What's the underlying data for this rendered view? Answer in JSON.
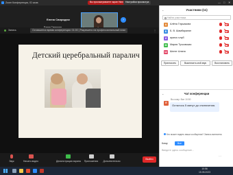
{
  "window": {
    "app_title": "Zoom Конференция, ID зала",
    "banner_red": "Вы просматриваете экран Нина",
    "banner_view": "Настройки просмотра",
    "controls": [
      "—",
      "□",
      "✕"
    ]
  },
  "videos": {
    "tile1_name": "Елена Свиридюк",
    "tile1_caption": "Елена Свиридюк",
    "tile2_caption": "Национальный институт"
  },
  "share_bar": {
    "view_label": "Запись",
    "notice": "Оставшееся время конференции: 01:00 | Разрешено на профессиональный план"
  },
  "slide": {
    "title": "Детский церебральный паралич"
  },
  "toolbar": {
    "items": [
      {
        "label": "Звук"
      },
      {
        "label": "Начать видео"
      },
      {
        "label": "Демонстрация экрана"
      },
      {
        "label": "Приложения"
      },
      {
        "label": "Дополнительно"
      }
    ],
    "exit": "Выйти"
  },
  "participants": {
    "title": "Участники (11)",
    "search_placeholder": "Найти участника",
    "list": [
      {
        "initials": "А",
        "name": "Алёна Глушакова",
        "color": "#e38a3a"
      },
      {
        "initials": "Б",
        "name": "Б. В. Шамбаранян",
        "color": "#3a8ee3"
      },
      {
        "initials": "И",
        "name": "ирина голуб",
        "color": "#8a5ce3"
      },
      {
        "initials": "М",
        "name": "Мария Тучковская",
        "color": "#3ebd4b"
      },
      {
        "initials": "Ш",
        "name": "Шелег Алина",
        "color": "#e34a6a"
      }
    ],
    "buttons": [
      "Пригласить",
      "Выключить мой звук",
      "Восстановить"
    ]
  },
  "chat": {
    "title": "Чат конференции",
    "meta": "Вы кому: Все  10:50",
    "sender_initial": "Е",
    "message": "Осталось 5 минут до отключения.",
    "hint": "Кто может видеть ваши сообщения? Запись включена",
    "to_label": "Кому:",
    "to_value": "Все",
    "input_placeholder": "Введите здесь сообщение...",
    "tools": "⋯"
  },
  "taskbar": {
    "time": "10:56",
    "date": "15.05.2023"
  },
  "colors": {
    "accent": "#2d8cff",
    "exit": "#e02828",
    "record": "#5aa640"
  }
}
